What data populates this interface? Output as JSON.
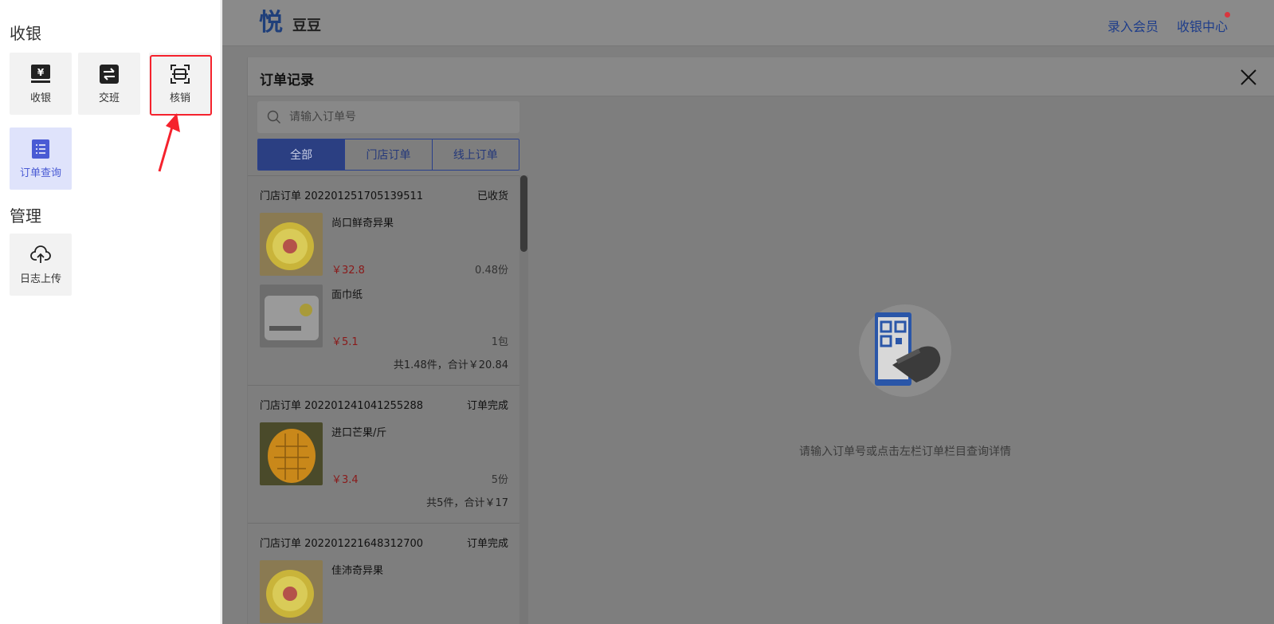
{
  "sidebar": {
    "sections": [
      {
        "title": "收银",
        "tiles": [
          {
            "label": "收银",
            "icon": "cash-register-icon"
          },
          {
            "label": "交班",
            "icon": "swap-icon"
          },
          {
            "label": "核销",
            "icon": "scan-icon"
          },
          {
            "label": "订单查询",
            "icon": "order-list-icon"
          }
        ]
      },
      {
        "title": "管理",
        "tiles": [
          {
            "label": "日志上传",
            "icon": "cloud-upload-icon"
          }
        ]
      }
    ]
  },
  "header": {
    "logo": "悦",
    "store_name": "豆豆",
    "links": [
      "录入会员",
      "收银中心"
    ]
  },
  "panel": {
    "title": "订单记录",
    "search_placeholder": "请输入订单号",
    "tabs": [
      "全部",
      "门店订单",
      "线上订单"
    ],
    "active_tab": 0,
    "orders": [
      {
        "title": "门店订单 202201251705139511",
        "status": "已收货",
        "items": [
          {
            "name": "尚口鲜奇异果",
            "price": "￥32.8",
            "qty": "0.48份",
            "image": "kiwi"
          },
          {
            "name": "面巾纸",
            "price": "￥5.1",
            "qty": "1包",
            "image": "tissue"
          }
        ],
        "total": "共1.48件，合计￥20.84"
      },
      {
        "title": "门店订单 202201241041255288",
        "status": "订单完成",
        "items": [
          {
            "name": "进口芒果/斤",
            "price": "￥3.4",
            "qty": "5份",
            "image": "mango"
          }
        ],
        "total": "共5件，合计￥17"
      },
      {
        "title": "门店订单 202201221648312700",
        "status": "订单完成",
        "items": [
          {
            "name": "佳沛奇异果",
            "price": "",
            "qty": "",
            "image": "kiwi"
          }
        ],
        "total": ""
      }
    ],
    "empty_text": "请输入订单号或点击左栏订单栏目查询详情"
  },
  "colors": {
    "accent": "#4a5bd4",
    "highlight": "#f5222d",
    "tab_active": "#2b3f82"
  }
}
